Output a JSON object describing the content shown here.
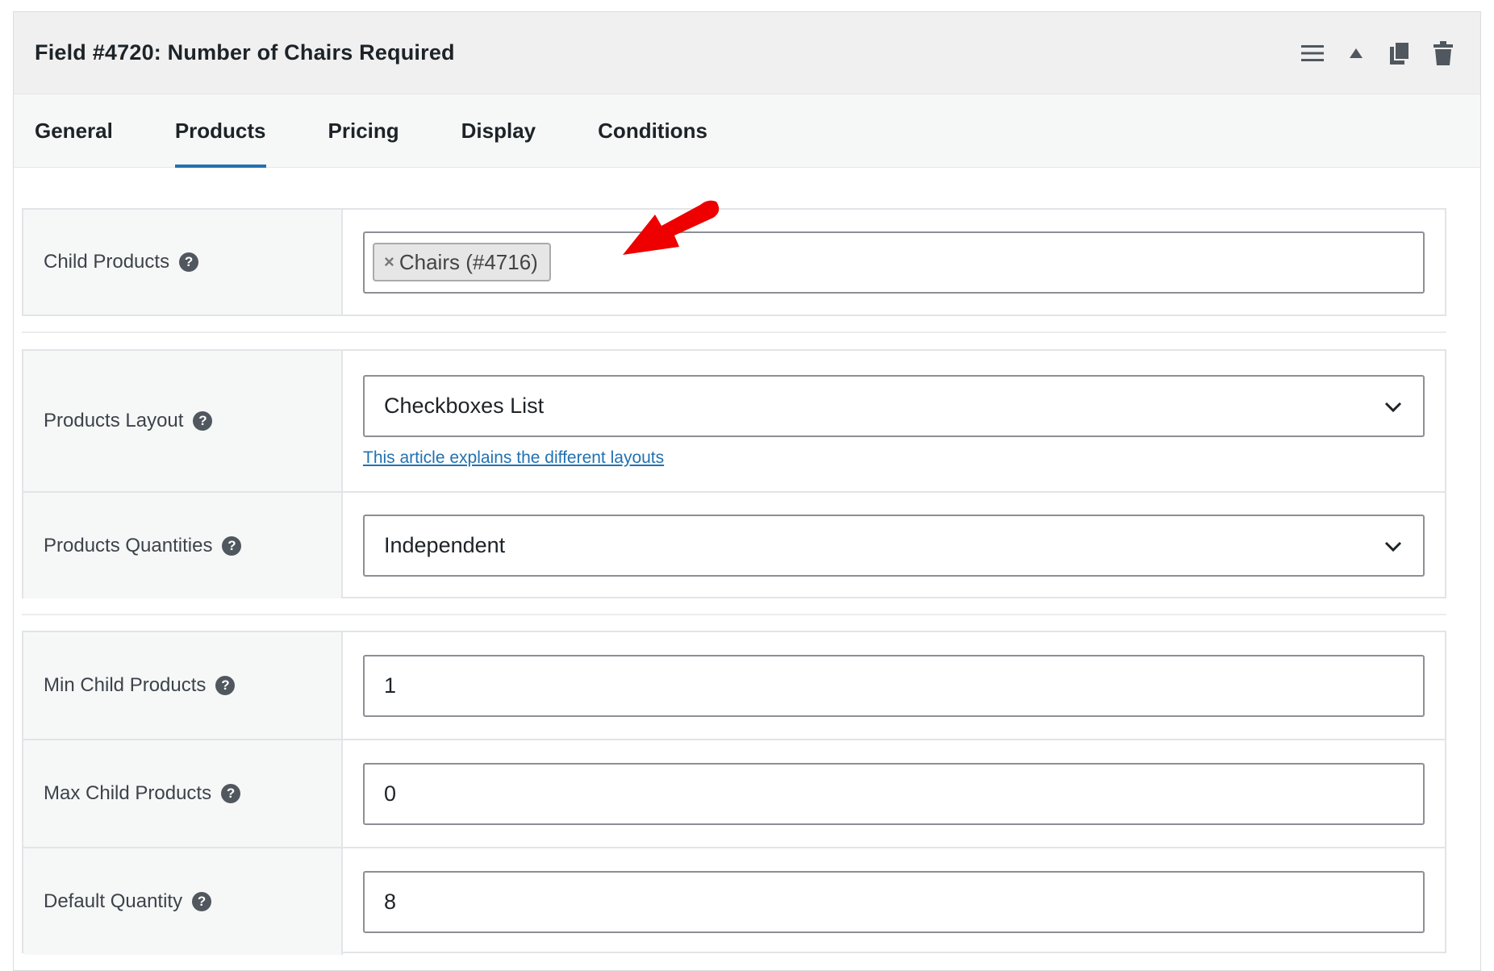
{
  "header": {
    "title": "Field #4720: Number of Chairs Required",
    "actions": [
      "menu-icon",
      "collapse-up-icon",
      "duplicate-icon",
      "trash-icon"
    ]
  },
  "tabs": [
    {
      "label": "General",
      "active": false
    },
    {
      "label": "Products",
      "active": true
    },
    {
      "label": "Pricing",
      "active": false
    },
    {
      "label": "Display",
      "active": false
    },
    {
      "label": "Conditions",
      "active": false
    }
  ],
  "child_products": {
    "label": "Child Products",
    "token_remove": "×",
    "token": "Chairs (#4716)"
  },
  "products_layout": {
    "label": "Products Layout",
    "value": "Checkboxes List",
    "link": "This article explains the different layouts"
  },
  "products_quantities": {
    "label": "Products Quantities",
    "value": "Independent"
  },
  "min_child": {
    "label": "Min Child Products",
    "value": "1"
  },
  "max_child": {
    "label": "Max Child Products",
    "value": "0"
  },
  "default_qty": {
    "label": "Default Quantity",
    "value": "8"
  },
  "help_glyph": "?",
  "colors": {
    "accent": "#2271b1",
    "annotation_arrow": "#ee0000"
  }
}
